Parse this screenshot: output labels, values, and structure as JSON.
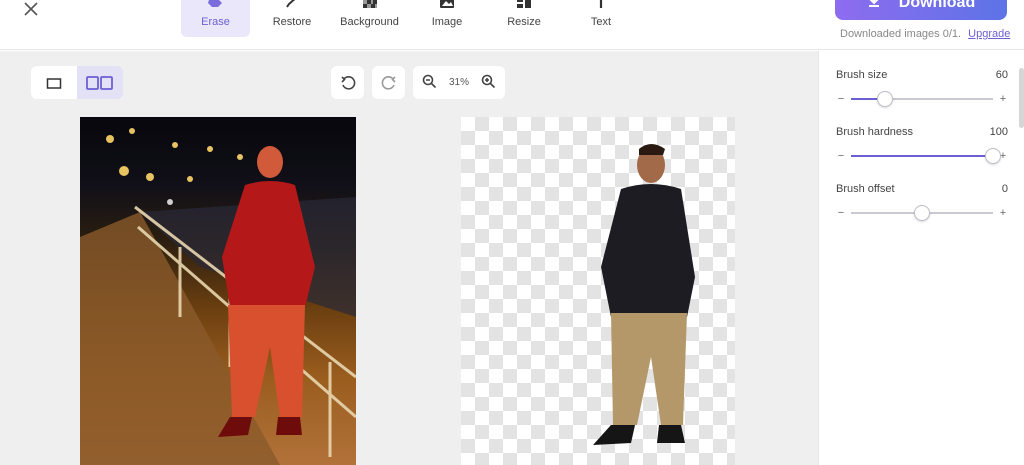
{
  "toolbar": {
    "tools": [
      {
        "label": "Erase",
        "icon": "eraser-icon",
        "active": true
      },
      {
        "label": "Restore",
        "icon": "brush-icon",
        "active": false
      },
      {
        "label": "Background",
        "icon": "checkerboard-icon",
        "active": false
      },
      {
        "label": "Image",
        "icon": "image-icon",
        "active": false
      },
      {
        "label": "Resize",
        "icon": "resize-icon",
        "active": false
      },
      {
        "label": "Text",
        "icon": "text-icon",
        "active": false
      }
    ],
    "download_label": "Download",
    "download_status": "Downloaded images 0/1.",
    "upgrade_label": "Upgrade"
  },
  "canvas": {
    "zoom_level": "31%",
    "view_mode": "split"
  },
  "settings": {
    "brush_size": {
      "label": "Brush size",
      "value": "60",
      "fraction": 0.24
    },
    "brush_hardness": {
      "label": "Brush hardness",
      "value": "100",
      "fraction": 1.0
    },
    "brush_offset": {
      "label": "Brush offset",
      "value": "0",
      "fraction": 0.5
    }
  },
  "colors": {
    "accent": "#6c5fd3",
    "download_gradient_start": "#8e6cf0",
    "download_gradient_end": "#5d73e6",
    "canvas_bg": "#efefef"
  }
}
